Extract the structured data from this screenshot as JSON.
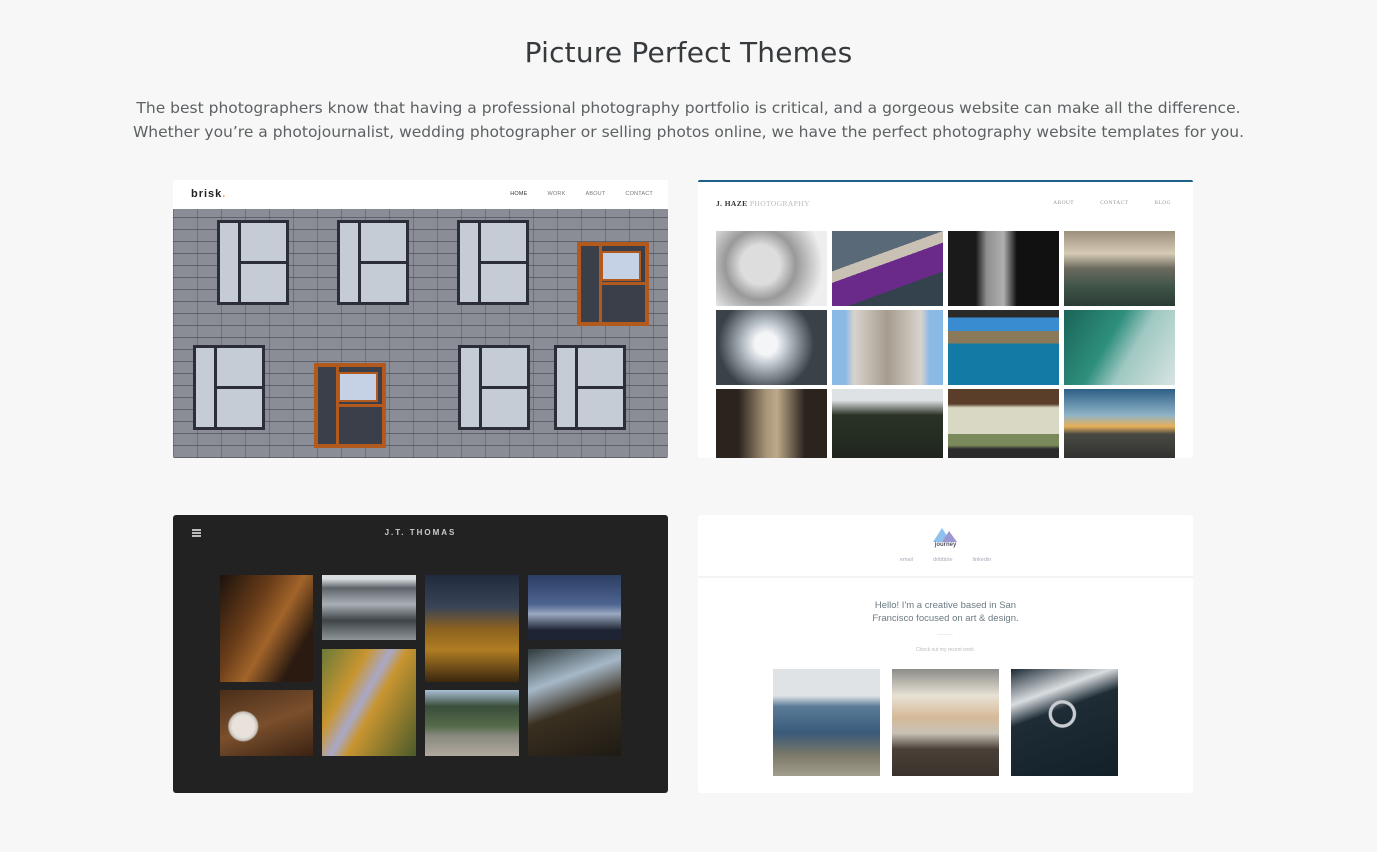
{
  "header": {
    "title": "Picture Perfect Themes",
    "intro_line1": "The best photographers know that having a professional photography portfolio is critical, and a gorgeous website can make all the difference.",
    "intro_line2": "Whether you’re a photojournalist, wedding photographer or selling photos online, we have the perfect photography website templates for you."
  },
  "themes": {
    "brisk": {
      "logo": "brisk",
      "logo_dot": ".",
      "nav": [
        "HOME",
        "WORK",
        "ABOUT",
        "CONTACT"
      ],
      "hero_image": "building-facade-windows"
    },
    "haze": {
      "logo_bold": "J. HAZE",
      "logo_light": "PHOTOGRAPHY",
      "nav": [
        "ABOUT",
        "CONTACT",
        "BLOG"
      ],
      "accent_color": "#1d6286",
      "photos": [
        "elderly-woman-portrait",
        "boat-woman-purple-dress",
        "man-portrait-dark",
        "ocean-sunset",
        "skyscrapers-looking-up",
        "tower-facade",
        "sea-cave-island",
        "green-wave",
        "misty-canal",
        "woman-mountains",
        "vintage-car-interior",
        "coastal-road-sunset"
      ]
    },
    "thomas": {
      "title": "J.T. THOMAS",
      "menu_icon": "hamburger-icon",
      "photos": [
        "night-castle-street",
        "stormy-sea",
        "desert-rock-night",
        "house-under-storm-sky",
        "coffee-cup-table",
        "forest-road-aerial",
        "mountain-lake-pier",
        "tall-trees-looking-up"
      ]
    },
    "journey": {
      "logo_name": "journey",
      "logo_icon": "mountain-icon",
      "links": [
        "email",
        "dribbble",
        "linkedin"
      ],
      "hello_line1": "Hello! I'm a creative based in San",
      "hello_line2": "Francisco focused on art & design.",
      "cta": "Check out my recent work.",
      "photos": [
        "machu-picchu",
        "beach-sunset",
        "car-steering-wheel"
      ]
    }
  }
}
